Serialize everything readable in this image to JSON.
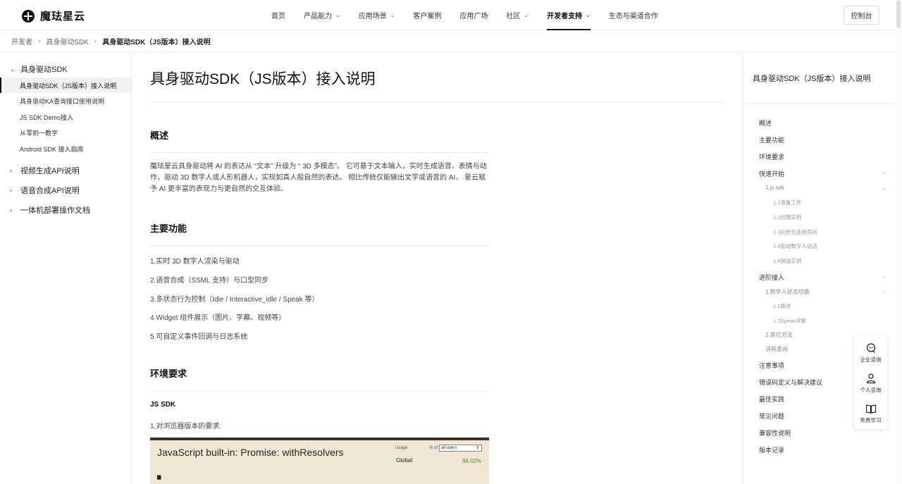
{
  "brand": {
    "name": "魔珐星云"
  },
  "nav": {
    "items": [
      {
        "label": "首页",
        "has_menu": false,
        "active": false
      },
      {
        "label": "产品能力",
        "has_menu": true,
        "active": false
      },
      {
        "label": "应用场景",
        "has_menu": true,
        "active": false
      },
      {
        "label": "客户案例",
        "has_menu": false,
        "active": false
      },
      {
        "label": "应用广场",
        "has_menu": false,
        "active": false
      },
      {
        "label": "社区",
        "has_menu": true,
        "active": false
      },
      {
        "label": "开发者支持",
        "has_menu": true,
        "active": true
      },
      {
        "label": "生态与渠道合作",
        "has_menu": false,
        "active": false
      }
    ],
    "console_label": "控制台"
  },
  "breadcrumb": [
    "开发者",
    "具身驱动SDK",
    "具身驱动SDK（JS版本）接入说明"
  ],
  "sidebar": {
    "groups": [
      {
        "title": "具身驱动SDK",
        "expanded": true,
        "items": [
          {
            "label": "具身驱动SDK（JS版本）接入说明",
            "active": true
          },
          {
            "label": "具身驱动KA查询接口使用说明",
            "active": false
          },
          {
            "label": "JS SDK Demo接入",
            "active": false
          },
          {
            "label": "从零到一教学",
            "active": false
          },
          {
            "label": "Android SDK 接入指南",
            "active": false
          }
        ]
      },
      {
        "title": "视频生成API说明",
        "expanded": false,
        "items": []
      },
      {
        "title": "语音合成API说明",
        "expanded": false,
        "items": []
      },
      {
        "title": "一体机部署操作文档",
        "expanded": false,
        "items": []
      }
    ]
  },
  "doc": {
    "title": "具身驱动SDK（JS版本）接入说明",
    "overview": {
      "heading": "概述",
      "text": "魔珐星云具身驱动将 AI 的表达从 “文本” 升级为 “ 3D 多模态”。 它可基于文本输入，实时生成语音、表情与动作，驱动 3D 数字人或人形机器人，实现如真人般自然的表达。 相比传统仅能输出文字或语音的 AI， 星云赋予 AI 更丰富的表现力与更自然的交互体验。"
    },
    "features": {
      "heading": "主要功能",
      "items": [
        "1.实时 3D 数字人渲染与驱动",
        "2.语音合成（SSML 支持）与口型同步",
        "3.多状态行为控制（Idle / Interactive_idle / Speak 等）",
        "4.Widget 组件展示（图片、字幕、视频等）",
        "5.可自定义事件回调与日志系统"
      ]
    },
    "env": {
      "heading": "环境要求",
      "sub_heading": "JS SDK",
      "browser_text": "1.对浏览器版本的要求:"
    },
    "embed": {
      "title": "JavaScript built-in: Promise: withResolvers",
      "usage_label": "Usage",
      "of_label": "% of",
      "select_value": "all users",
      "global_label": "Global",
      "global_pct": "86.02%"
    }
  },
  "toc": {
    "heading": "具身驱动SDK（JS版本）接入说明",
    "items": [
      {
        "label": "概述",
        "level": 1,
        "expandable": false
      },
      {
        "label": "主要功能",
        "level": 1,
        "expandable": false
      },
      {
        "label": "环境要求",
        "level": 1,
        "expandable": false
      },
      {
        "label": "快速开始",
        "level": 1,
        "expandable": true
      },
      {
        "label": "1.js sdk",
        "level": 2,
        "expandable": true
      },
      {
        "label": "1.1准备工作",
        "level": 3,
        "expandable": false
      },
      {
        "label": "1.2创建实例",
        "level": 3,
        "expandable": false
      },
      {
        "label": "1.3初始化连接房间",
        "level": 3,
        "expandable": false
      },
      {
        "label": "1.4驱动数字人说话",
        "level": 3,
        "expandable": false
      },
      {
        "label": "1.5销毁实例",
        "level": 3,
        "expandable": false
      },
      {
        "label": "进阶接入",
        "level": 1,
        "expandable": true
      },
      {
        "label": "1.数字人状态切换",
        "level": 2,
        "expandable": true
      },
      {
        "label": "1.1概述",
        "level": 3,
        "expandable": false
      },
      {
        "label": "1.2Speak详解",
        "level": 3,
        "expandable": false
      },
      {
        "label": "2.其它方法",
        "level": 2,
        "expandable": false
      },
      {
        "label": "消耗查询",
        "level": 2,
        "expandable": false
      },
      {
        "label": "注意事项",
        "level": 1,
        "expandable": false
      },
      {
        "label": "错误码定义与解决建议",
        "level": 1,
        "expandable": false
      },
      {
        "label": "最佳实践",
        "level": 1,
        "expandable": false
      },
      {
        "label": "常见问题",
        "level": 1,
        "expandable": false
      },
      {
        "label": "兼容性说明",
        "level": 1,
        "expandable": false
      },
      {
        "label": "版本记录",
        "level": 1,
        "expandable": false
      }
    ]
  },
  "float": {
    "enterprise_label": "企业咨询",
    "personal_label": "个人咨询",
    "learn_label": "免费学习"
  }
}
